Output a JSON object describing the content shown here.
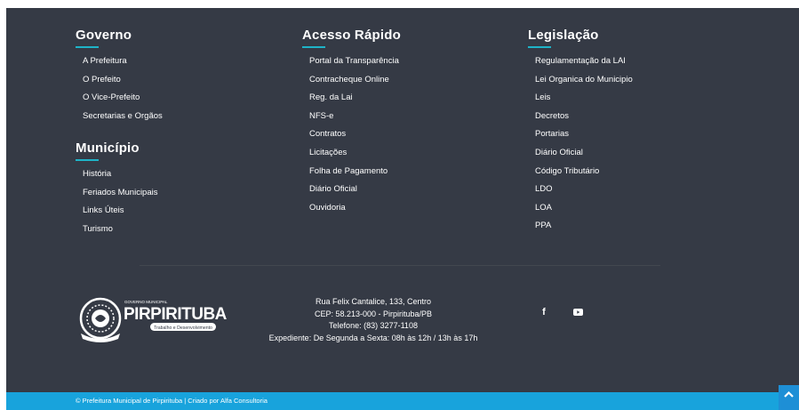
{
  "governo": {
    "title": "Governo",
    "items": [
      "A Prefeitura",
      "O Prefeito",
      "O Vice-Prefeito",
      "Secretarias e Orgãos"
    ]
  },
  "municipio": {
    "title": "Município",
    "items": [
      "História",
      "Feriados Municipais",
      "Links Úteis",
      "Turismo"
    ]
  },
  "acesso": {
    "title": "Acesso Rápido",
    "items": [
      "Portal da Transparência",
      "Contracheque Online",
      "Reg. da Lai",
      "NFS-e",
      "Contratos",
      "Licitações",
      "Folha de Pagamento",
      "Diário Oficial",
      "Ouvidoria"
    ]
  },
  "legislacao": {
    "title": "Legislação",
    "items": [
      "Regulamentação da LAI",
      "Lei Organica do Municipio",
      "Leis",
      "Decretos",
      "Portarias",
      "Diário Oficial",
      "Código Tributário",
      "LDO",
      "LOA",
      "PPA"
    ]
  },
  "brand": {
    "name": "PIRPIRITUBA",
    "top": "GOVERNO MUNICIPAL",
    "tagline": "Trabalho e Desenvolvimento"
  },
  "address": {
    "line1": "Rua Felix Cantalice, 133, Centro",
    "line2": "CEP: 58.213-000 - Pirpirituba/PB",
    "line3": "Telefone: (83) 3277-1108",
    "line4": "Expediente: De Segunda a Sexta: 08h às 12h / 13h às 17h"
  },
  "social": {
    "facebook_icon": "facebook-icon",
    "youtube_icon": "youtube-icon"
  },
  "footer": {
    "copyright": "© Prefeitura Municipal de Pirpirituba | Criado por Alfa Consultoria"
  },
  "colors": {
    "background": "#353a45",
    "accent": "#1eb4c8",
    "bottom_bar": "#18a3dc",
    "scroll_button": "#1e8fd6"
  }
}
